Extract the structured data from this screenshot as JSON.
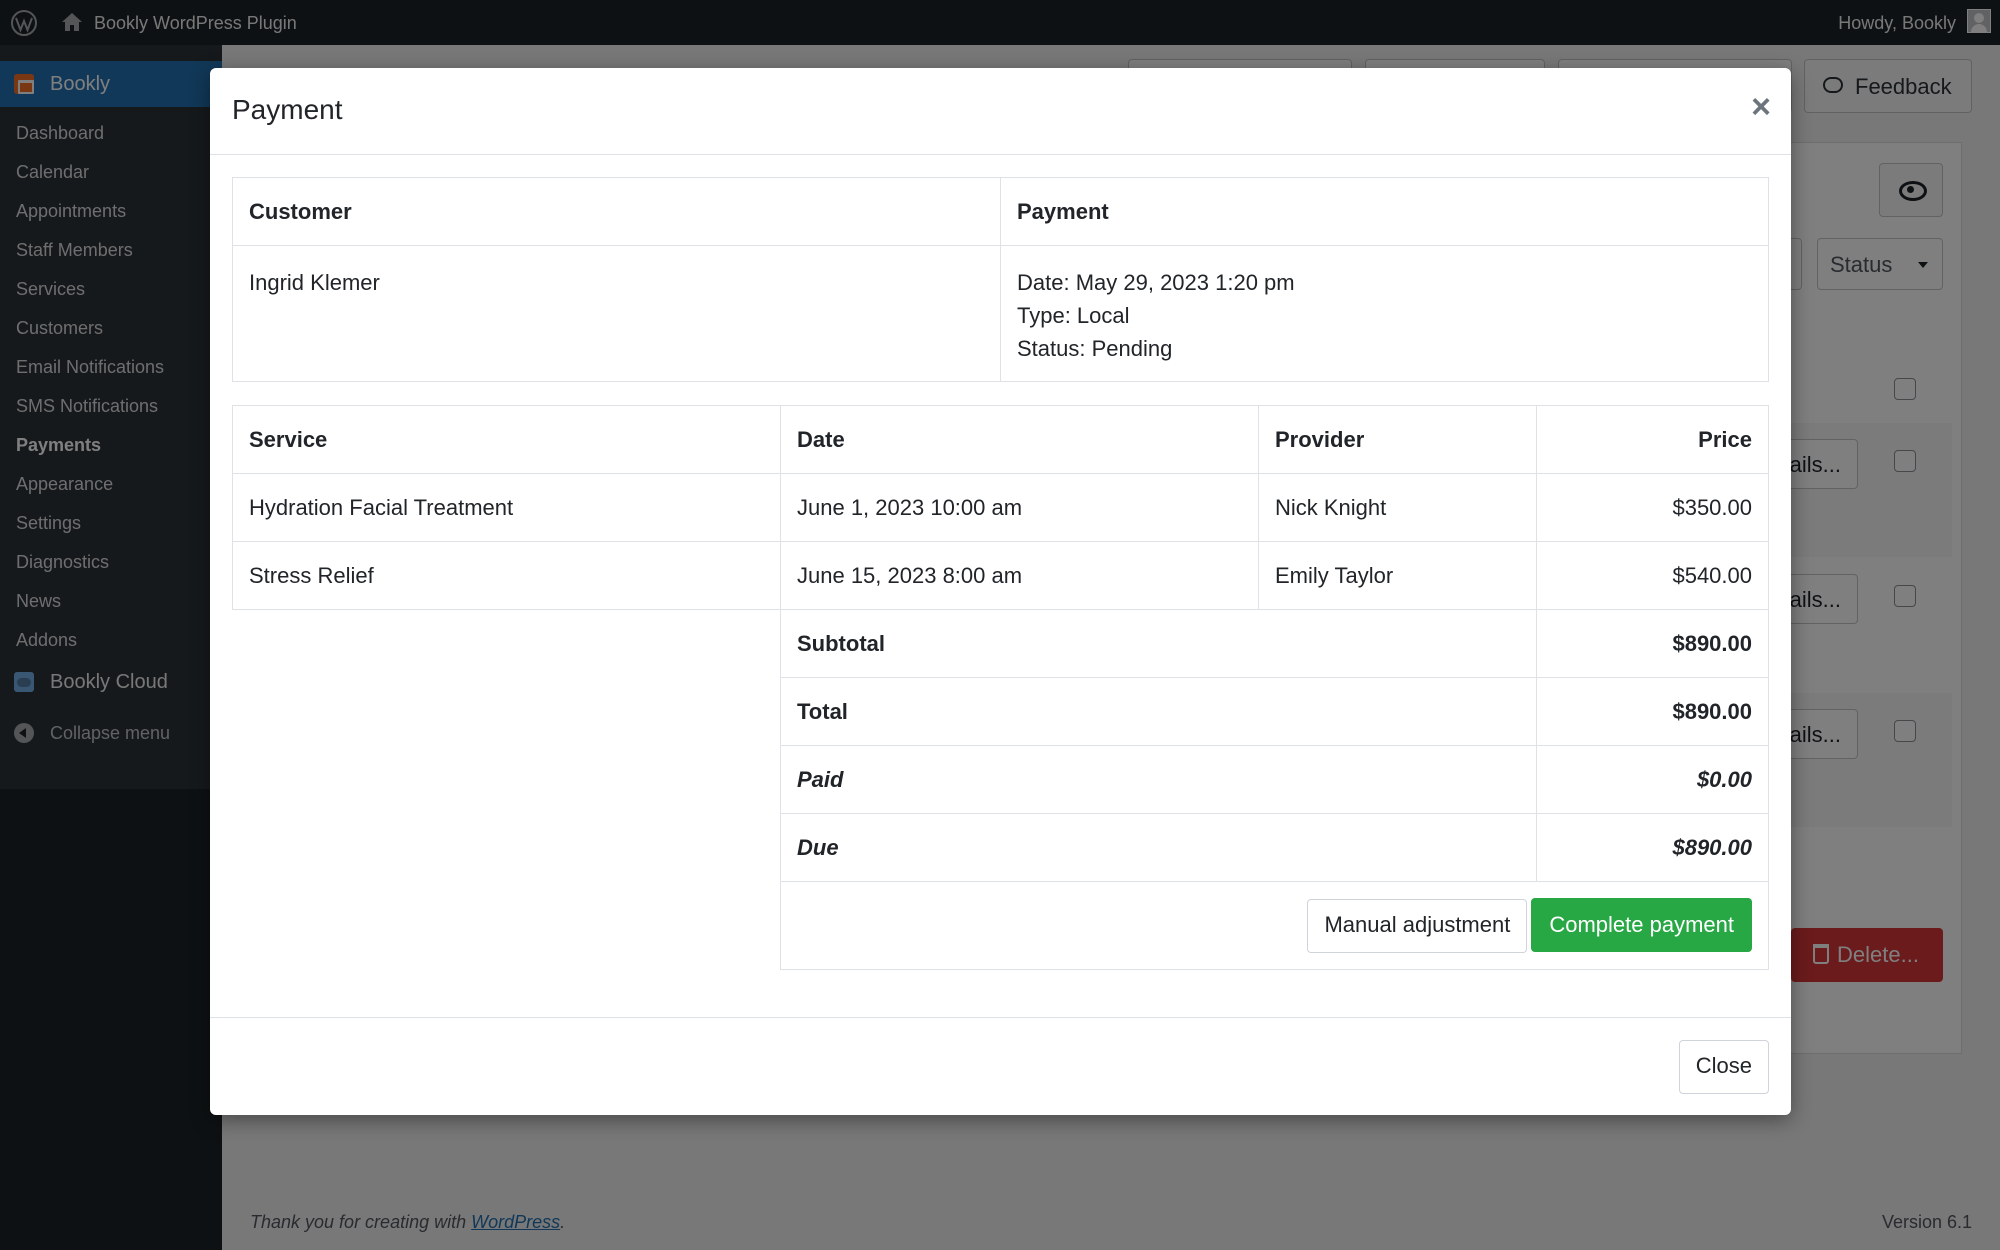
{
  "adminbar": {
    "site_name": "Bookly WordPress Plugin",
    "howdy": "Howdy, Bookly"
  },
  "sidebar": {
    "current": "Bookly",
    "items": [
      {
        "label": "Dashboard"
      },
      {
        "label": "Calendar"
      },
      {
        "label": "Appointments"
      },
      {
        "label": "Staff Members"
      },
      {
        "label": "Services"
      },
      {
        "label": "Customers"
      },
      {
        "label": "Email Notifications"
      },
      {
        "label": "SMS Notifications"
      },
      {
        "label": "Payments",
        "active": true
      },
      {
        "label": "Appearance"
      },
      {
        "label": "Settings"
      },
      {
        "label": "Diagnostics"
      },
      {
        "label": "News"
      },
      {
        "label": "Addons"
      }
    ],
    "cloud": "Bookly Cloud",
    "collapse": "Collapse menu"
  },
  "background": {
    "feedback": "Feedback",
    "status": "Status",
    "details": "ails...",
    "delete": "Delete...",
    "footer_thanks": "Thank you for creating with ",
    "footer_link": "WordPress",
    "footer_dot": ".",
    "version": "Version 6.1"
  },
  "modal": {
    "title": "Payment",
    "close_x": "×",
    "customer_header": "Customer",
    "payment_header": "Payment",
    "customer_name": "Ingrid Klemer",
    "payment_date": "Date: May 29, 2023 1:20 pm",
    "payment_type": "Type: Local",
    "payment_status": "Status: Pending",
    "columns": {
      "service": "Service",
      "date": "Date",
      "provider": "Provider",
      "price": "Price"
    },
    "rows": [
      {
        "service": "Hydration Facial Treatment",
        "date": "June 1, 2023 10:00 am",
        "provider": "Nick Knight",
        "price": "$350.00"
      },
      {
        "service": "Stress Relief",
        "date": "June 15, 2023 8:00 am",
        "provider": "Emily Taylor",
        "price": "$540.00"
      }
    ],
    "totals": {
      "subtotal_label": "Subtotal",
      "subtotal": "$890.00",
      "total_label": "Total",
      "total": "$890.00",
      "paid_label": "Paid",
      "paid": "$0.00",
      "due_label": "Due",
      "due": "$890.00"
    },
    "manual_adjustment": "Manual adjustment",
    "complete_payment": "Complete payment",
    "close_button": "Close"
  }
}
